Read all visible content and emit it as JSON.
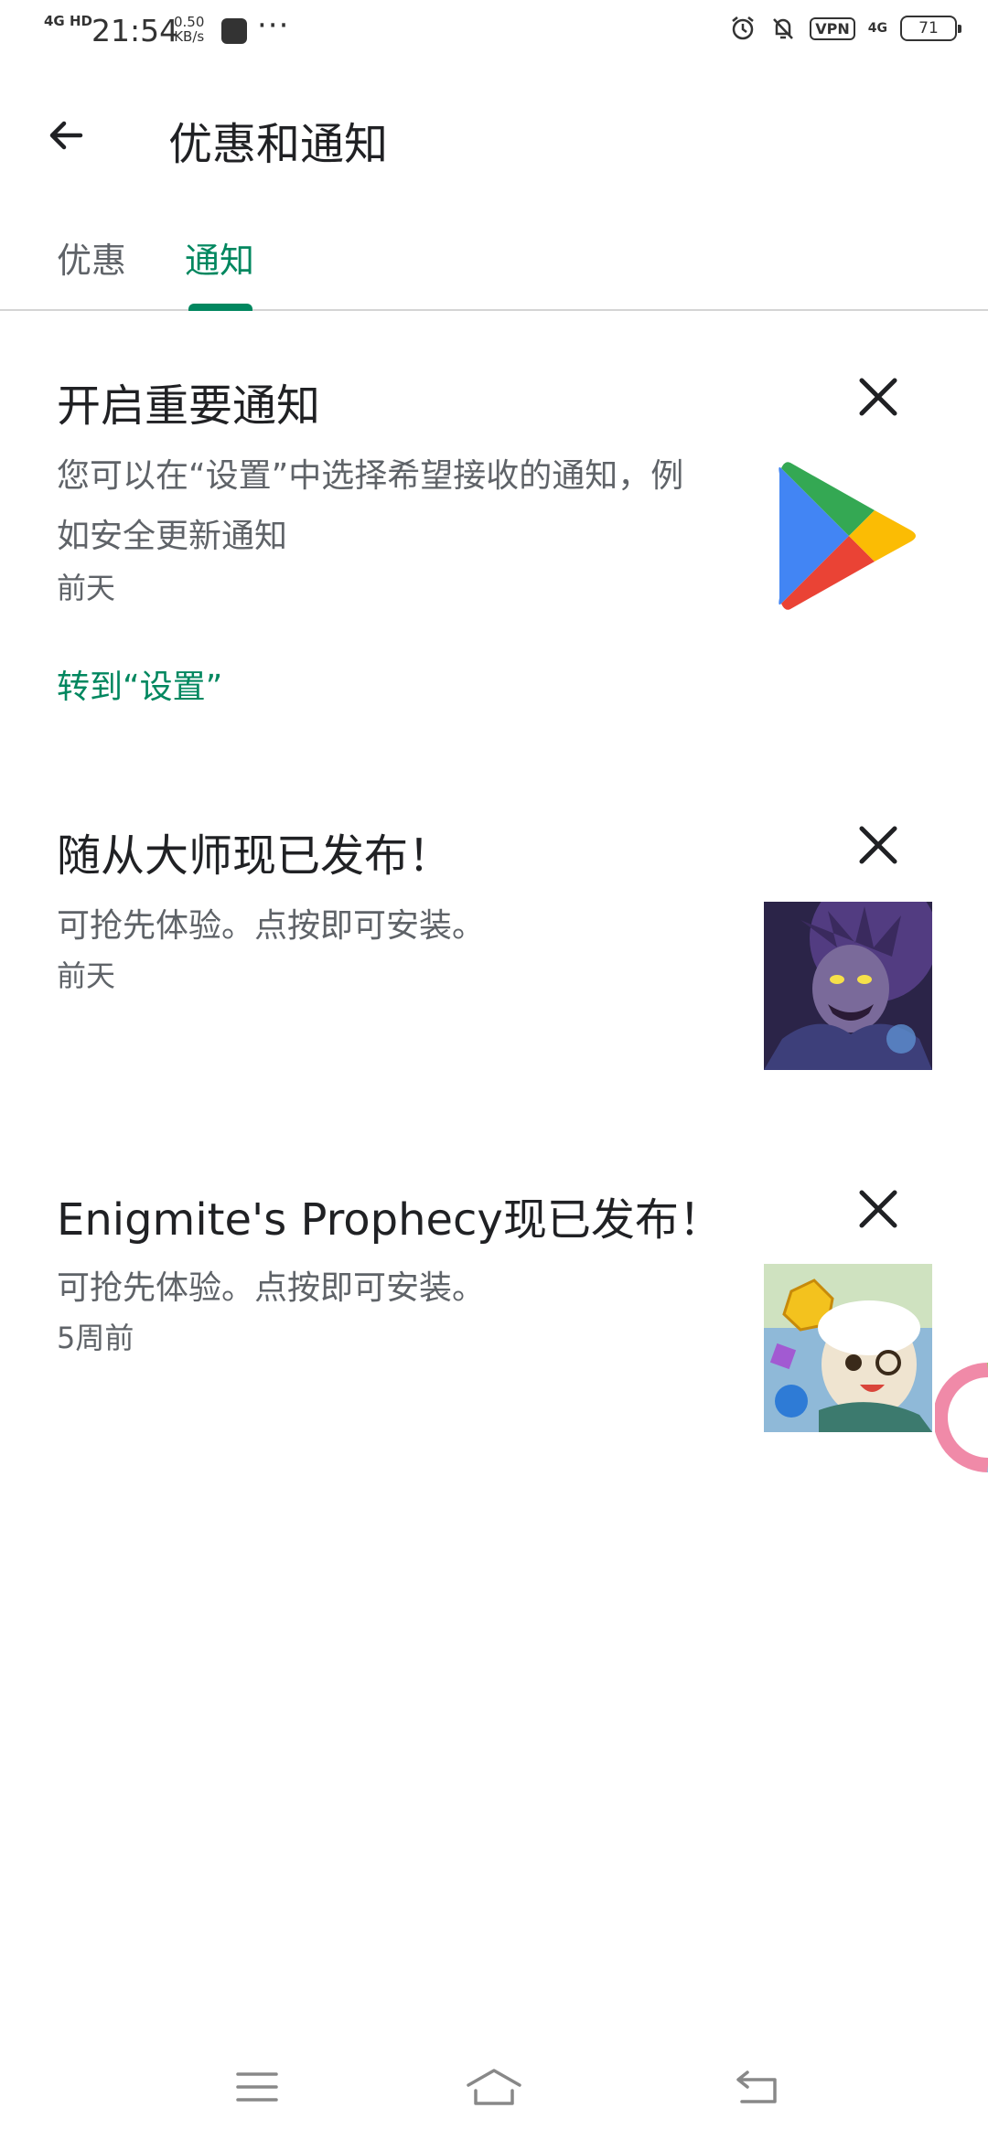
{
  "status_bar": {
    "network": "4G HD",
    "time": "21:54",
    "speed_value": "0.50",
    "speed_unit": "KB/s",
    "more": "···",
    "vpn": "VPN",
    "mobile_data": "4G",
    "battery": "71"
  },
  "header": {
    "title": "优惠和通知"
  },
  "tabs": [
    {
      "label": "优惠",
      "selected": false
    },
    {
      "label": "通知",
      "selected": true
    }
  ],
  "notifications": [
    {
      "title": "开启重要通知",
      "body": "您可以在“设置”中选择希望接收的通知，例如安全更新通知",
      "time": "前天",
      "link": "转到“设置”",
      "icon": "google-play-icon"
    },
    {
      "title": "随从大师现已发布！",
      "body": "可抢先体验。点按即可安装。",
      "time": "前天",
      "icon": "game-artwork-dark-character"
    },
    {
      "title": "Enigmite's Prophecy现已发布！",
      "body": "可抢先体验。点按即可安装。",
      "time": "5周前",
      "icon": "game-artwork-puzzle-creature"
    }
  ],
  "colors": {
    "accent": "#01875f",
    "text_primary": "#202124",
    "text_secondary": "#5f6368"
  }
}
